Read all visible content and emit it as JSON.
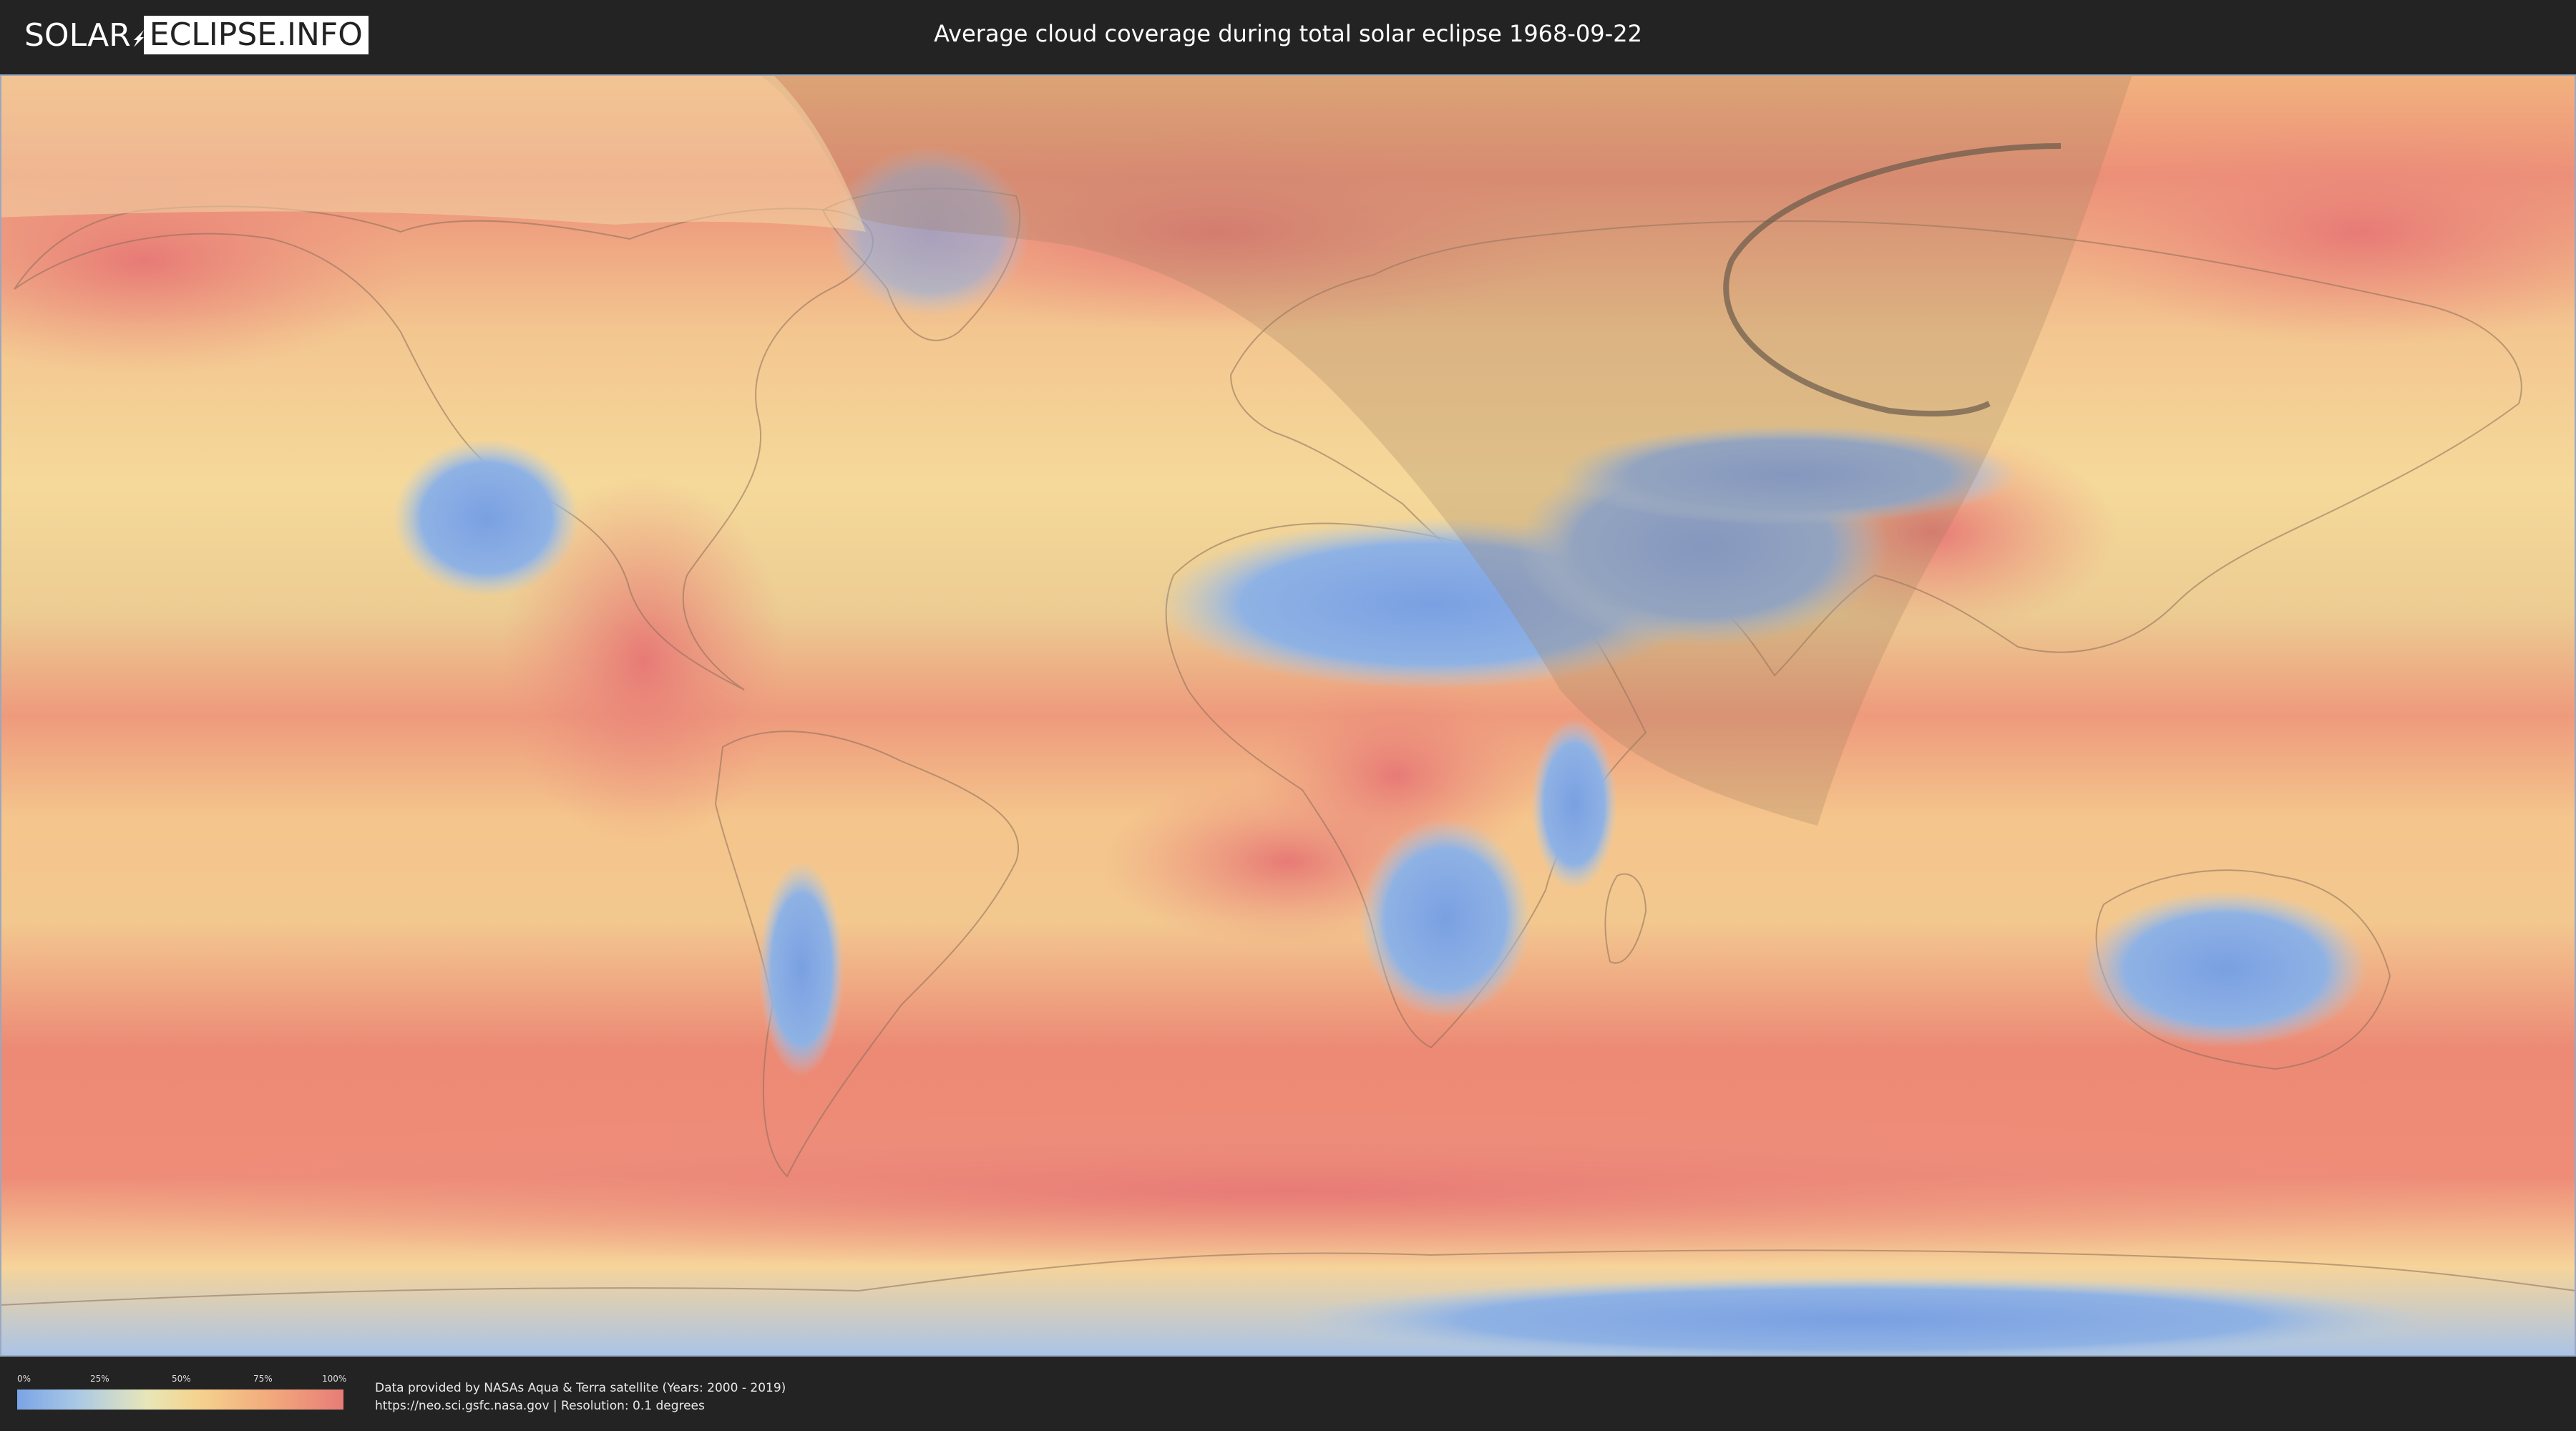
{
  "header": {
    "logo_left": "SOLAR",
    "logo_right": "ECLIPSE.INFO",
    "title": "Average cloud coverage during total solar eclipse 1968-09-22"
  },
  "map": {
    "projection": "equirectangular world map",
    "layer": "average cloud coverage",
    "eclipse_date": "1968-09-22",
    "colors": {
      "low_cloud": "#7aa4e6",
      "mid_cloud": "#f5d38e",
      "high_cloud": "#e87c78",
      "night_shade": "#a08060"
    }
  },
  "legend": {
    "ticks": [
      "0%",
      "25%",
      "50%",
      "75%",
      "100%"
    ],
    "gradient_colors": [
      "#7aa4e6",
      "#a9c8e6",
      "#e8e6b8",
      "#f5d38e",
      "#f2a97c",
      "#e87c78"
    ]
  },
  "footer": {
    "credit_line1": "Data provided by NASAs Aqua & Terra satellite (Years: 2000 - 2019)",
    "credit_line2": "https://neo.sci.gsfc.nasa.gov | Resolution: 0.1 degrees"
  }
}
